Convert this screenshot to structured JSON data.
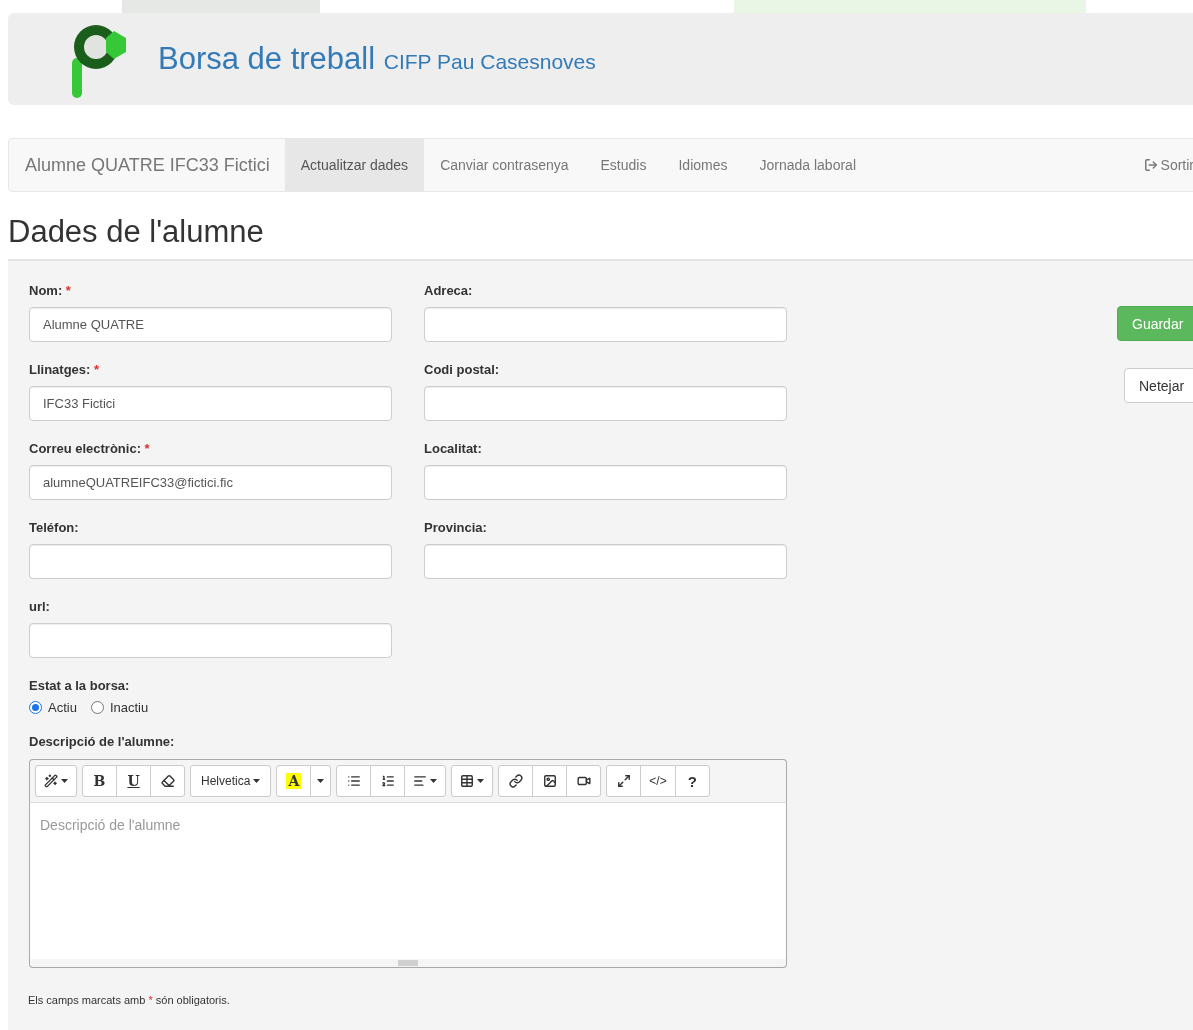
{
  "header": {
    "title": "Borsa de treball",
    "subtitle": "CIFP Pau Casesnoves"
  },
  "navbar": {
    "brand": "Alumne QUATRE IFC33 Fictici",
    "tabs": [
      {
        "label": "Actualitzar dades",
        "selected": true
      },
      {
        "label": "Canviar contrasenya",
        "selected": false
      },
      {
        "label": "Estudis",
        "selected": false
      },
      {
        "label": "Idiomes",
        "selected": false
      },
      {
        "label": "Jornada laboral",
        "selected": false
      }
    ],
    "logout": "Sortir"
  },
  "heading": "Dades de l'alumne",
  "left_fields": [
    {
      "label": "Nom:",
      "required_mark": "*",
      "value": "Alumne QUATRE"
    },
    {
      "label": "Llinatges:",
      "required_mark": "*",
      "value": "IFC33 Fictici"
    },
    {
      "label": "Correu electrònic:",
      "required_mark": "*",
      "value": "alumneQUATREIFC33@fictici.fic"
    },
    {
      "label": "Teléfon:"
    },
    {
      "label": "url:"
    }
  ],
  "right_fields": [
    {
      "label": "Adreca:"
    },
    {
      "label": "Codi postal:"
    },
    {
      "label": "Localitat:"
    },
    {
      "label": "Provincia:"
    }
  ],
  "status": {
    "label": "Estat a la borsa:",
    "options": [
      {
        "label": "Actiu",
        "selected": true
      },
      {
        "label": "Inactiu",
        "selected": false
      }
    ]
  },
  "description": {
    "label": "Descripció de l'alumne:",
    "placeholder": "Descripció de l'alumne",
    "toolbar": [
      [
        {
          "kind": "wand"
        }
      ],
      [
        {
          "kind": "bold",
          "label": "B"
        },
        {
          "kind": "underline",
          "label": "U"
        },
        {
          "kind": "eraser"
        }
      ],
      [
        {
          "kind": "font",
          "label": "Helvetica"
        }
      ],
      [
        {
          "kind": "color",
          "label": "A"
        },
        {
          "kind": "caret"
        }
      ],
      [
        {
          "kind": "bullets"
        },
        {
          "kind": "numbers"
        },
        {
          "kind": "align"
        }
      ],
      [
        {
          "kind": "table"
        }
      ],
      [
        {
          "kind": "link"
        },
        {
          "kind": "image"
        },
        {
          "kind": "video"
        }
      ],
      [
        {
          "kind": "fullscreen"
        },
        {
          "kind": "code",
          "label": "</>"
        },
        {
          "kind": "help",
          "label": "?"
        }
      ]
    ]
  },
  "note": {
    "before": "Els camps marcats amb",
    "mark": "*",
    "after": "són obligatoris."
  },
  "buttons": [
    {
      "kind": "primary",
      "label": "Guardar"
    },
    {
      "kind": "default",
      "label": "Netejar"
    }
  ]
}
